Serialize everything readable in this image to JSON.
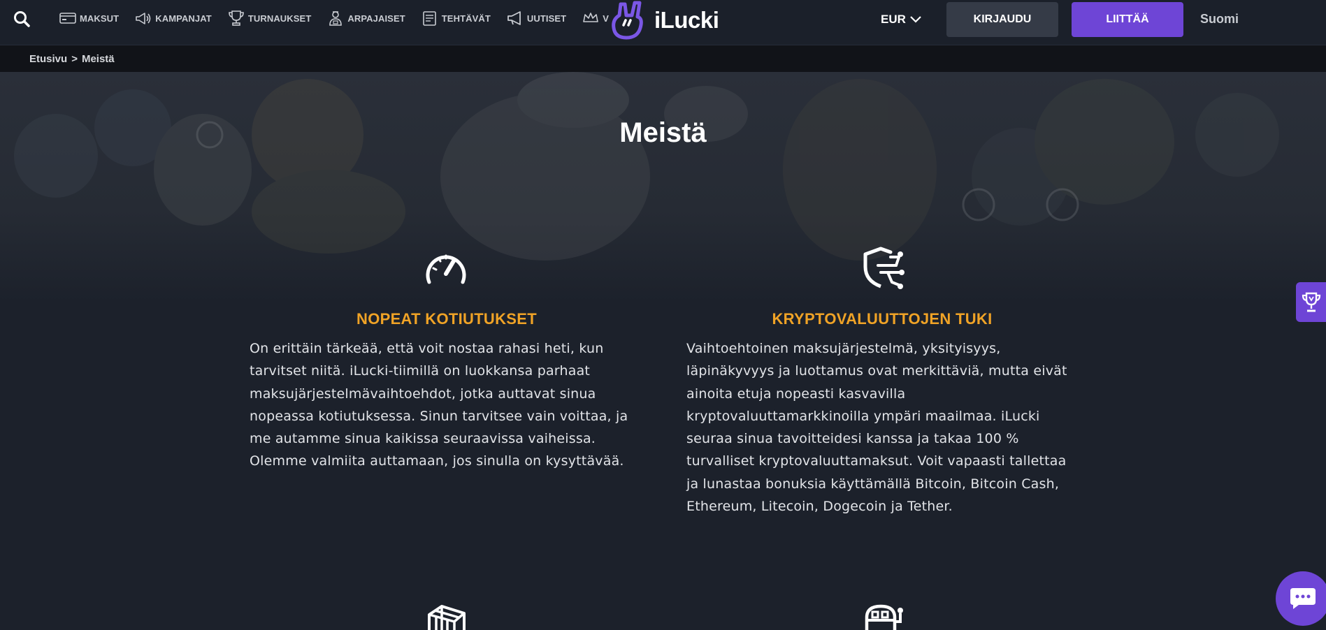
{
  "header": {
    "nav": [
      {
        "label": "MAKSUT",
        "icon": "card-icon"
      },
      {
        "label": "KAMPANJAT",
        "icon": "megaphone-icon"
      },
      {
        "label": "TURNAUKSET",
        "icon": "trophy-icon"
      },
      {
        "label": "ARPAJAISET",
        "icon": "person-icon"
      },
      {
        "label": "TEHTÄVÄT",
        "icon": "notepad-icon"
      },
      {
        "label": "UUTISET",
        "icon": "loudspeaker-icon"
      },
      {
        "label": "V",
        "icon": "crown-icon"
      }
    ],
    "logo_text": "iLucki",
    "currency": "EUR",
    "login_label": "KIRJAUDU",
    "join_label": "LIITTÄÄ",
    "language": "Suomi"
  },
  "breadcrumb": {
    "home": "Etusivu",
    "separator": ">",
    "current": "Meistä"
  },
  "hero": {
    "title": "Meistä"
  },
  "features": [
    {
      "icon": "speedometer-icon",
      "title": "NOPEAT KOTIUTUKSET",
      "lines": [
        "On erittäin tärkeää, että voit nostaa rahasi heti, kun",
        "tarvitset niitä. iLucki-tiimillä on luokkansa parhaat",
        "maksujärjestelmävaihtoehdot, jotka auttavat sinua",
        "nopeassa kotiutuksessa. Sinun tarvitsee vain voittaa, ja",
        "me autamme sinua kaikissa seuraavissa vaiheissa.",
        "Olemme valmiita auttamaan, jos sinulla on kysyttävää."
      ]
    },
    {
      "icon": "crypto-shield-icon",
      "title": "KRYPTOVALUUTTOJEN TUKI",
      "lines": [
        "Vaihtoehtoinen maksujärjestelmä, yksityisyys,",
        "läpinäkyvyys ja luottamus ovat merkittäviä, mutta eivät",
        "ainoita etuja nopeasti kasvavilla",
        "kryptovaluuttamarkkinoilla ympäri maailmaa. iLucki",
        "seuraa sinua tavoitteidesi kanssa ja takaa 100 %",
        "turvalliset kryptovaluuttamaksut. Voit vapaasti tallettaa",
        "ja lunastaa bonuksia käyttämällä Bitcoin, Bitcoin Cash,",
        "Ethereum, Litecoin, Dogecoin ja Tether."
      ]
    }
  ],
  "accent_colors": {
    "brand": "#6e45d6",
    "feature_title": "#f0a326",
    "background": "#1c212b"
  }
}
